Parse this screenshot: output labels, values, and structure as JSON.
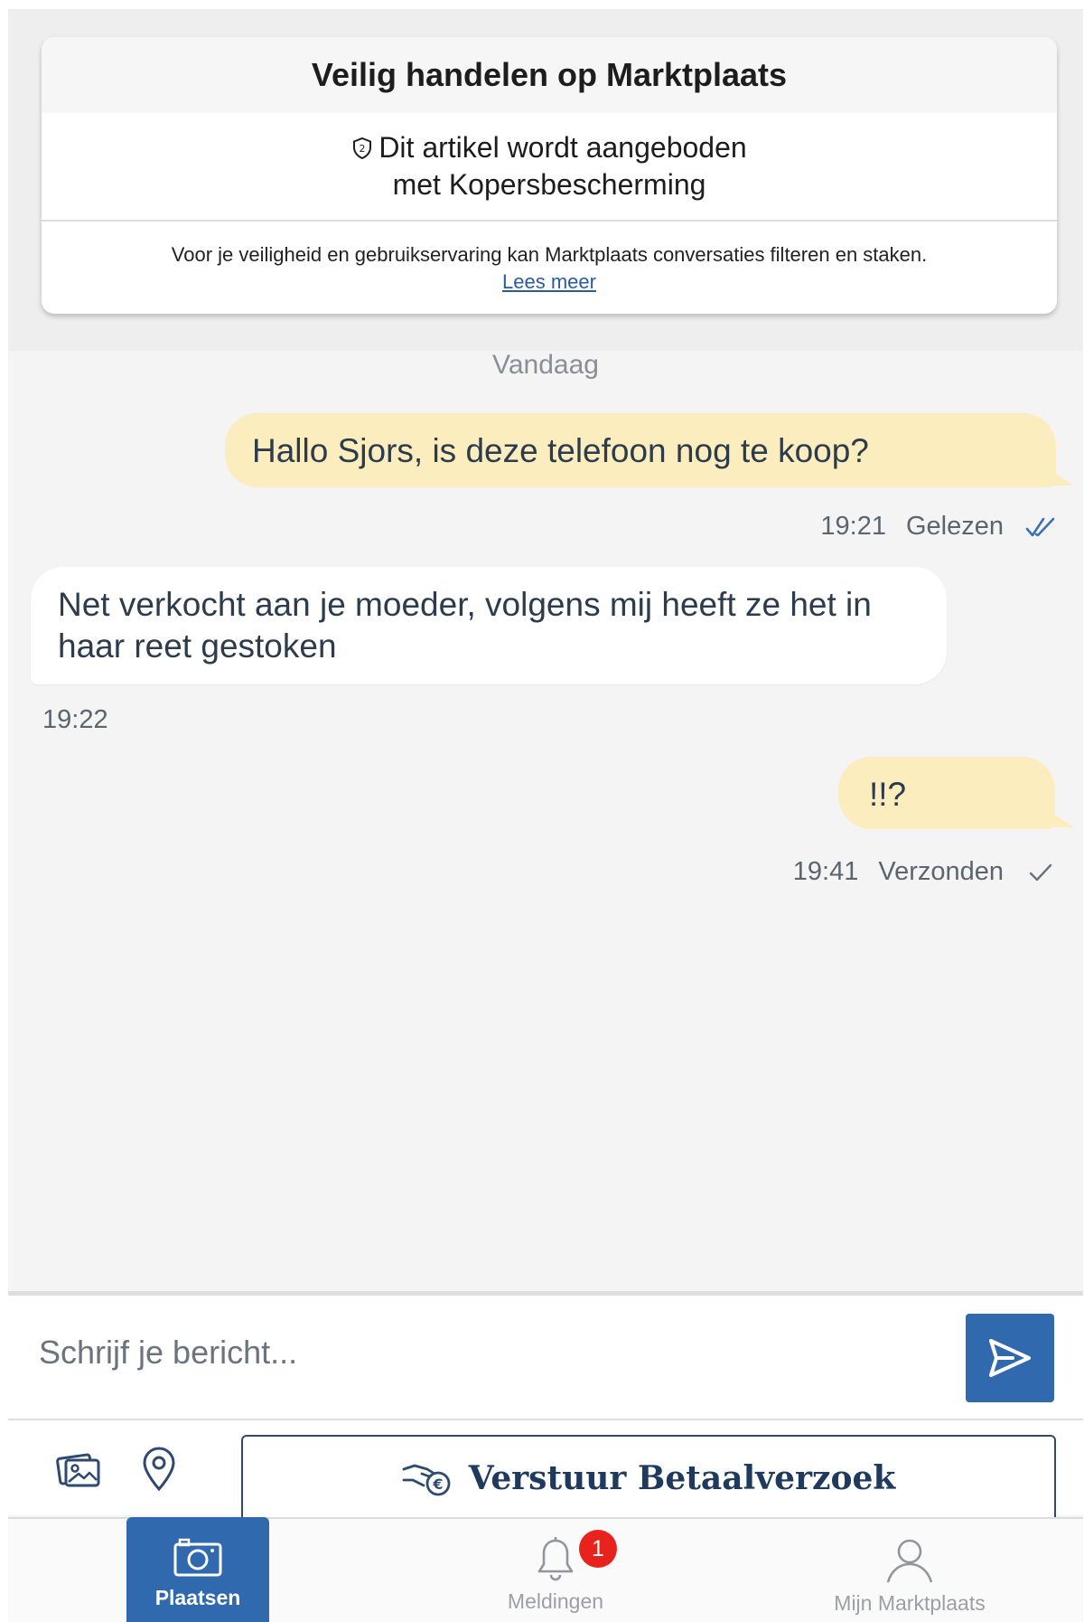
{
  "safety": {
    "title": "Veilig handelen op Marktplaats",
    "protection_line1": "Dit artikel wordt aangeboden",
    "protection_line2": "met Kopersbescherming",
    "note": "Voor je veiligheid en gebruikservaring kan Marktplaats conversaties filteren en staken.",
    "link": "Lees meer"
  },
  "conversation": {
    "day_label": "Vandaag",
    "messages": [
      {
        "direction": "outgoing",
        "text": "Hallo Sjors, is deze telefoon nog te koop?",
        "time": "19:21",
        "status": "Gelezen",
        "status_icon": "double-check-icon"
      },
      {
        "direction": "incoming",
        "text": "Net verkocht aan je moeder, volgens mij heeft ze het in haar reet gestoken",
        "time": "19:22"
      },
      {
        "direction": "outgoing",
        "text": "!!?",
        "time": "19:41",
        "status": "Verzonden",
        "status_icon": "check-icon"
      }
    ]
  },
  "composer": {
    "placeholder": "Schrijf je bericht...",
    "payment_button": "Verstuur Betaalverzoek"
  },
  "tabbar": {
    "tabs": [
      {
        "label": "Plaatsen",
        "icon": "camera-icon",
        "active": true
      },
      {
        "label": "Meldingen",
        "icon": "bell-icon",
        "badge": "1"
      },
      {
        "label": "Mijn Marktplaats",
        "icon": "user-icon"
      }
    ]
  },
  "colors": {
    "accent": "#3169ae",
    "outgoing_bubble": "#fbedbe",
    "incoming_bubble": "#ffffff",
    "badge": "#e8231d"
  }
}
